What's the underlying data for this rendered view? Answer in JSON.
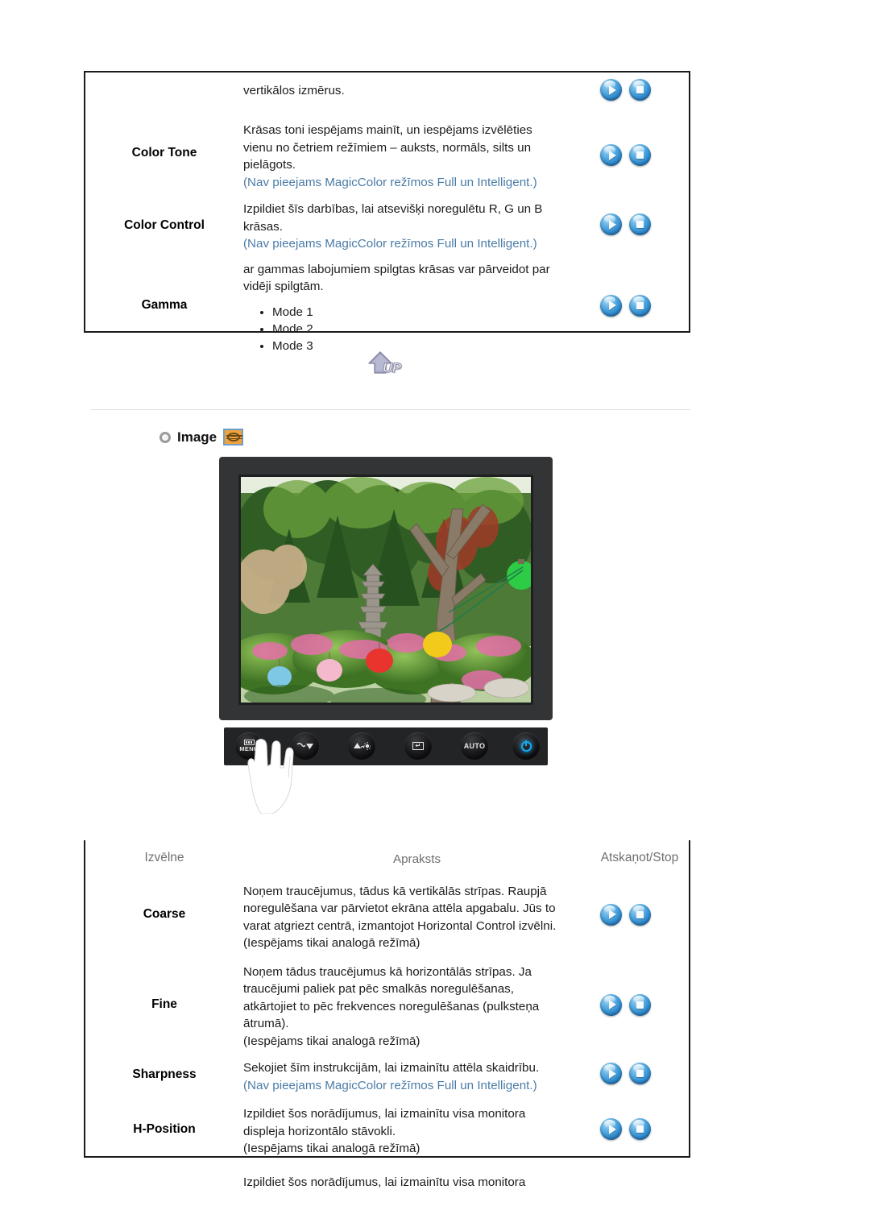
{
  "colors": {
    "note_blue": "#4a7ba7",
    "table_border": "#1a1a1a",
    "header_gray": "#6f6f6f",
    "icon_orange": "#f0a33c",
    "power_blue": "#16a9f0"
  },
  "top_table": {
    "rows": [
      {
        "menu": "",
        "lines": [
          "vertikālos izmērus."
        ],
        "note": "",
        "bullets": [],
        "buttons": {
          "play": "play-button",
          "stop": "stop-button"
        }
      },
      {
        "menu": "Color Tone",
        "lines": [
          "Krāsas toni iespējams mainīt, un iespējams izvēlēties",
          "vienu no četriem režīmiem – auksts, normāls, silts un",
          "pielāgots."
        ],
        "note": "(Nav pieejams MagicColor režīmos Full un Intelligent.)",
        "bullets": [],
        "buttons": {
          "play": "play-button",
          "stop": "stop-button"
        }
      },
      {
        "menu": "Color Control",
        "lines": [
          "Izpildiet šīs darbības, lai atsevišķi noregulētu R, G un B",
          "krāsas."
        ],
        "note": "(Nav pieejams MagicColor režīmos Full un Intelligent.)",
        "bullets": [],
        "buttons": {
          "play": "play-button",
          "stop": "stop-button"
        }
      },
      {
        "menu": "Gamma",
        "lines": [
          "ar gammas labojumiem spilgtas krāsas var pārveidot par",
          "vidēji spilgtām."
        ],
        "note": "",
        "bullets": [
          "Mode 1",
          "Mode 2",
          "Mode 3"
        ],
        "buttons": {
          "play": "play-button",
          "stop": "stop-button"
        }
      }
    ]
  },
  "up_button": {
    "label": "UP",
    "icon": "up-arrow-icon"
  },
  "image_section": {
    "bullet_icon": "ring-bullet-icon",
    "title": "Image",
    "osd_icon": "osd-image-icon"
  },
  "monitor": {
    "buttons": [
      {
        "name": "menu-button",
        "label": "MENU",
        "icon": "menu-bars-icon"
      },
      {
        "name": "down-button",
        "label": "",
        "icon": "down-arrow-icon"
      },
      {
        "name": "brightness-button",
        "label": "",
        "icon": "brightness-sun-icon"
      },
      {
        "name": "enter-button",
        "label": "",
        "icon": "enter-icon"
      },
      {
        "name": "auto-button",
        "label": "AUTO",
        "icon": "auto-text-icon"
      },
      {
        "name": "power-button",
        "label": "",
        "icon": "power-icon"
      }
    ],
    "hand_cursor": "hand-pointing-icon",
    "screen_description": "garden-photo"
  },
  "bottom_table": {
    "headers": [
      "Izvēlne",
      "Apraksts",
      "Atskaņot/Stop"
    ],
    "rows": [
      {
        "menu": "Coarse",
        "lines": [
          "Noņem traucējumus, tādus kā vertikālās strīpas. Raupjā",
          "noregulēšana var pārvietot ekrāna attēla apgabalu. Jūs to",
          "varat atgriezt centrā, izmantojot Horizontal Control izvēlni.",
          "(Iespējams tikai analogā režīmā)"
        ],
        "note": "",
        "buttons": {
          "play": "play-button",
          "stop": "stop-button"
        }
      },
      {
        "menu": "Fine",
        "lines": [
          "Noņem tādus traucējumus kā horizontālās strīpas. Ja",
          "traucējumi paliek pat pēc smalkās noregulēšanas,",
          "atkārtojiet to pēc frekvences noregulēšanas (pulksteņa",
          "ātrumā).",
          "(Iespējams tikai analogā režīmā)"
        ],
        "note": "",
        "buttons": {
          "play": "play-button",
          "stop": "stop-button"
        }
      },
      {
        "menu": "Sharpness",
        "lines": [
          "Sekojiet šīm instrukcijām, lai izmainītu attēla skaidrību."
        ],
        "note": "(Nav pieejams MagicColor režīmos Full un Intelligent.)",
        "buttons": {
          "play": "play-button",
          "stop": "stop-button"
        }
      },
      {
        "menu": "H-Position",
        "lines": [
          "Izpildiet šos norādījumus, lai izmainītu visa monitora",
          "displeja horizontālo stāvokli.",
          "(Iespējams tikai analogā režīmā)"
        ],
        "note": "",
        "buttons": {
          "play": "play-button",
          "stop": "stop-button"
        }
      },
      {
        "menu": "",
        "lines": [
          "Izpildiet šos norādījumus, lai izmainītu visa monitora"
        ],
        "note": "",
        "buttons": null
      }
    ]
  }
}
